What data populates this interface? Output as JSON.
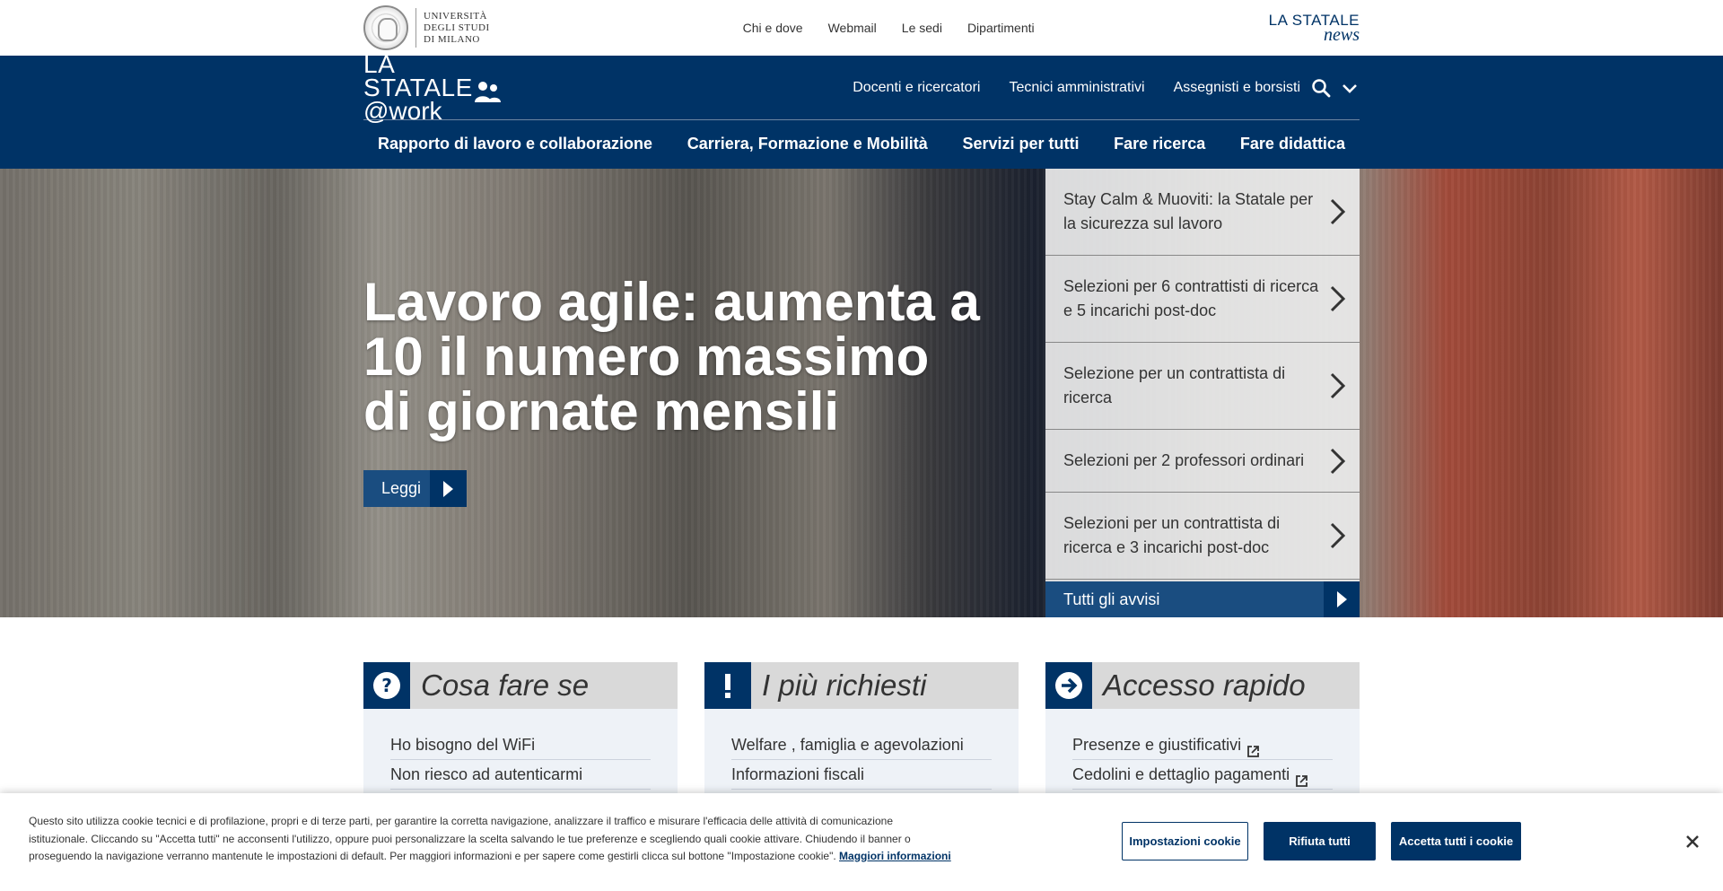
{
  "topbar": {
    "university_name": "UNIVERSITÀ\nDEGLI STUDI\nDI MILANO",
    "nav": [
      "Chi e dove",
      "Webmail",
      "Le sedi",
      "Dipartimenti"
    ],
    "news_logo_line1": "LA STATALE",
    "news_logo_line2": "news"
  },
  "header": {
    "logo_line1": "LA STATALE",
    "logo_line2": "@work",
    "audience_nav": [
      "Docenti e ricercatori",
      "Tecnici amministrativi",
      "Assegnisti e borsisti"
    ],
    "main_nav": [
      "Rapporto di lavoro e collaborazione",
      "Carriera, Formazione e Mobilità",
      "Servizi per tutti",
      "Fare ricerca",
      "Fare didattica"
    ]
  },
  "hero": {
    "title": "Lavoro agile: aumenta a 10 il numero massimo di giornate mensili",
    "read_label": "Leggi",
    "notices": [
      "Stay Calm & Muoviti: la Statale per la sicurezza sul lavoro",
      "Selezioni per 6 contrattisti di ricerca e 5 incarichi post-doc",
      "Selezione per un contrattista di ricerca",
      "Selezioni per 2 professori ordinari",
      "Selezioni per un contrattista di ricerca e 3 incarichi post-doc"
    ],
    "all_notices_label": "Tutti gli avvisi"
  },
  "cards": [
    {
      "title": "Cosa fare se",
      "icon": "question-icon",
      "links": [
        "Ho bisogno del WiFi",
        "Non riesco ad autenticarmi"
      ]
    },
    {
      "title": "I più richiesti",
      "icon": "exclamation-icon",
      "links": [
        "Welfare , famiglia e agevolazioni",
        "Informazioni fiscali"
      ]
    },
    {
      "title": "Accesso rapido",
      "icon": "arrow-circle-icon",
      "links": [
        "Presenze e giustificativi",
        "Cedolini e dettaglio pagamenti"
      ]
    }
  ],
  "cookie": {
    "message": "Questo sito utilizza cookie tecnici e di profilazione, propri e di terze parti, per garantire la corretta navigazione, analizzare il traffico e misurare l'efficacia delle attività di comunicazione istituzionale. Cliccando su \"Accetta tutti\" ne acconsenti l'utilizzo, oppure puoi personalizzare la scelta salvando le tue preferenze e scegliendo quali cookie attivare. Chiudendo il banner o proseguendo la navigazione verranno mantenute le impostazioni di default. Per maggiori informazioni e per sapere come gestirli clicca sul bottone \"Impostazione cookie\".",
    "more_link": "Maggiori informazioni",
    "settings_label": "Impostazioni cookie",
    "reject_label": "Rifiuta tutti",
    "accept_label": "Accetta tutti i cookie"
  },
  "colors": {
    "primary": "#003366",
    "secondary": "#1a4d80",
    "card_bg": "#eef2f7"
  }
}
